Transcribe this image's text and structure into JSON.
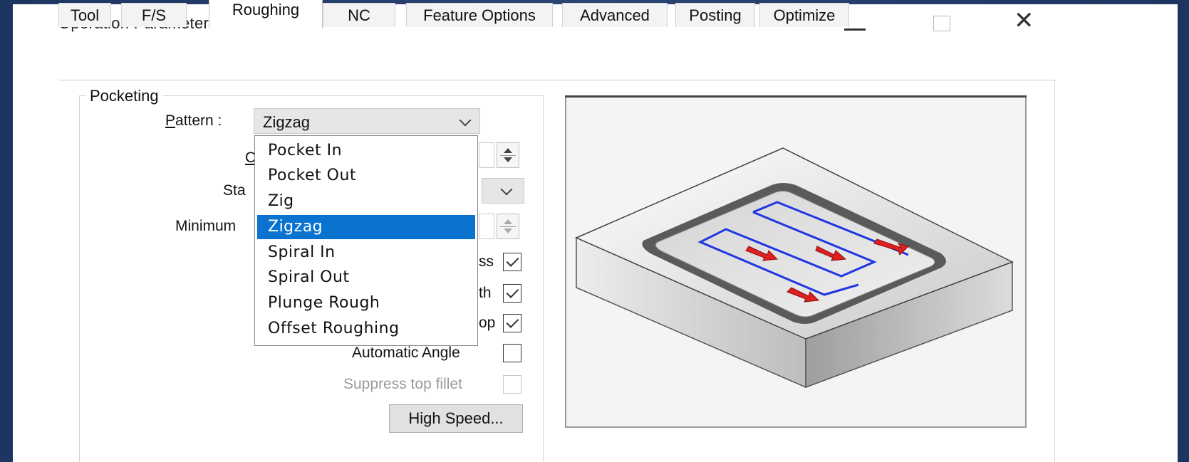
{
  "window": {
    "title": "Operation Parameters",
    "controls": [
      "minimize",
      "maximize",
      "close"
    ]
  },
  "tabs": [
    {
      "label": "Tool",
      "active": false
    },
    {
      "label": "F/S",
      "active": false
    },
    {
      "label": "Roughing",
      "active": true
    },
    {
      "label": "NC",
      "active": false
    },
    {
      "label": "Feature Options",
      "active": false
    },
    {
      "label": "Advanced",
      "active": false
    },
    {
      "label": "Posting",
      "active": false
    },
    {
      "label": "Optimize",
      "active": false
    }
  ],
  "pocketing": {
    "group_label": "Pocketing",
    "pattern_label": "Pattern :",
    "pattern_value": "Zigzag",
    "partial_labels": {
      "row2": "C",
      "start": "Sta",
      "minimum": "Minimum"
    }
  },
  "dropdown": {
    "items": [
      "Pocket In",
      "Pocket Out",
      "Zig",
      "Zigzag",
      "Spiral In",
      "Spiral Out",
      "Plunge Rough",
      "Offset Roughing"
    ],
    "selected": "Zigzag"
  },
  "options": {
    "hidden_fragments": [
      "ss",
      "th",
      "op"
    ],
    "checkboxes": [
      {
        "label": "",
        "checked": true,
        "enabled": true
      },
      {
        "label": "",
        "checked": true,
        "enabled": true
      },
      {
        "label": "",
        "checked": true,
        "enabled": true
      },
      {
        "label": "Automatic Angle",
        "checked": false,
        "enabled": true
      },
      {
        "label": "Suppress top fillet",
        "checked": false,
        "enabled": false
      }
    ]
  },
  "buttons": {
    "high_speed": "High Speed..."
  },
  "preview": {
    "description_icon": "zigzag-pocket-toolpath-illustration"
  }
}
